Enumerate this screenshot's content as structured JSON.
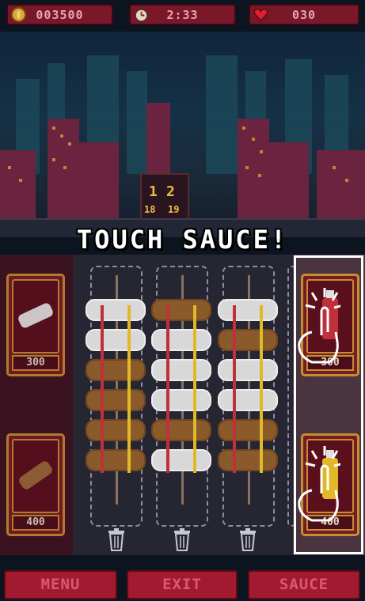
{
  "hud": {
    "coins": "003500",
    "timer": "2:33",
    "lives": "030"
  },
  "icons": {
    "coins": "coin-icon",
    "timer": "stopwatch-icon",
    "lives": "heart-icon",
    "trash": "trash-can-icon",
    "hand": "tap-hand-icon"
  },
  "city_sign": {
    "digits_top": [
      "1",
      "2"
    ],
    "digits_bottom": [
      "18",
      "19"
    ]
  },
  "instruction": "TOUCH SAUCE!",
  "ingredients": [
    {
      "name": "tofu",
      "price": "300"
    },
    {
      "name": "sausage",
      "price": "400"
    }
  ],
  "sauces": [
    {
      "name": "ketchup",
      "price": "300"
    },
    {
      "name": "mustard",
      "price": "400"
    }
  ],
  "skewers": [
    {
      "items": [
        "cream",
        "cream",
        "brown",
        "brown",
        "brown",
        "brown"
      ],
      "sauce": [
        "ketchup",
        "mustard"
      ]
    },
    {
      "items": [
        "brown",
        "cream",
        "cream",
        "cream",
        "brown",
        "cream"
      ],
      "sauce": [
        "ketchup",
        "mustard"
      ]
    },
    {
      "items": [
        "cream",
        "brown",
        "cream",
        "cream",
        "brown",
        "brown"
      ],
      "sauce": [
        "ketchup",
        "mustard"
      ]
    }
  ],
  "buttons": {
    "menu": "MENU",
    "exit": "EXIT",
    "sauce": "SAUCE"
  },
  "colors": {
    "hud_bg": "#7a1728",
    "card_border": "#c29030",
    "ketchup": "#c0303a",
    "mustard": "#e0b828",
    "button_bg": "#a11a30"
  }
}
